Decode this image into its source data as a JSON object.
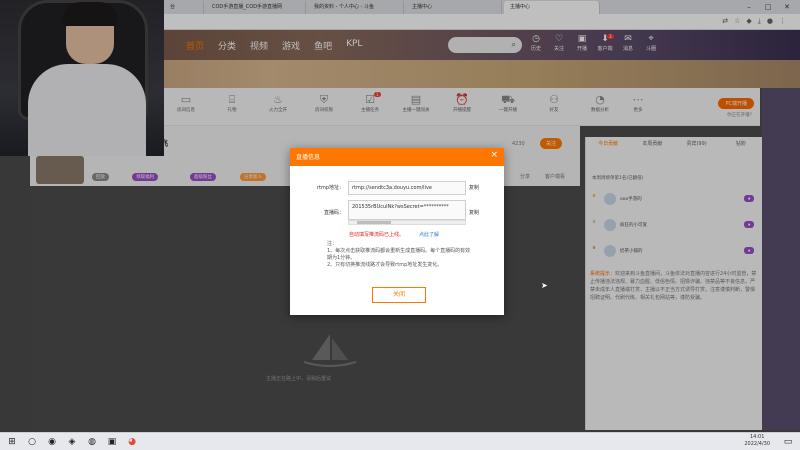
{
  "browser": {
    "tabs": [
      {
        "label": "台"
      },
      {
        "label": "COD手游直播_COD手游直播网"
      },
      {
        "label": "我的资料 - 个人中心 - 斗鱼"
      },
      {
        "label": "主播中心"
      },
      {
        "label": "主播中心"
      }
    ],
    "window_controls": [
      "–",
      "□",
      "✕"
    ]
  },
  "site": {
    "nav": [
      "首页",
      "分类",
      "视频",
      "游戏",
      "鱼吧",
      "KPL"
    ],
    "header_icons": [
      {
        "label": "历史"
      },
      {
        "label": "关注"
      },
      {
        "label": "开播"
      },
      {
        "label": "客户端"
      },
      {
        "label": "消息"
      },
      {
        "label": "斗圈"
      }
    ],
    "header_badge": "3",
    "toolbar": [
      {
        "label": "房间信息"
      },
      {
        "label": "礼物"
      },
      {
        "label": "火力全开"
      },
      {
        "label": "房间权限"
      },
      {
        "label": "主播任务"
      },
      {
        "label": "主播一键闯关"
      },
      {
        "label": "开播提醒"
      },
      {
        "label": "一键开播"
      },
      {
        "label": "好友"
      },
      {
        "label": "数据分析"
      },
      {
        "label": "更多"
      }
    ],
    "toolbar_badge": "1",
    "pc_button": "PC端开播",
    "pc_sub": "你正在开播?",
    "follow_count": "4230",
    "follow_label": "关注"
  },
  "room": {
    "anchor_name": "超飞",
    "tags": [
      "回放",
      "领取福利",
      "超级粉丝",
      "分享新人"
    ],
    "actions": [
      "分享",
      "客户端看"
    ],
    "offline_text": "主播正在路上中，请稍后重试"
  },
  "right_panel": {
    "tabs": [
      "今日贡献",
      "本周贡献",
      "贵宾(99)",
      "钻粉"
    ],
    "top_link": "本周周榜单第1名(已翻倍)",
    "ranks": [
      {
        "name": "ooo手游的"
      },
      {
        "name": "疯狂的小可爱"
      },
      {
        "name": "奶茶小铺的"
      }
    ],
    "notice_title": "系统提示：",
    "notice_text": "欢迎来到斗鱼直播间，斗鱼依法对直播内容进行24小时监管，禁止传播违法违规、暴力血腥、低俗色情、招嫖诈骗、违禁品等不良信息。严禁未成年人直播或打赏，主播以不正当方式诱导打赏，注意谨慎判断，警惕招聘证明、代刷代练、相关礼包网站等，谨防受骗。"
  },
  "modal": {
    "title": "直播信息",
    "rtmp_label": "rtmp地址：",
    "rtmp_value": "rtmp://sendtc3a.douyu.com/live",
    "key_label": "直播码：",
    "key_value": "201535rBUcuINk?wsSecret=**********",
    "copy_label": "复制",
    "warn_text": "自动填写推流码已上线。",
    "learn_text": "点此了解",
    "note_text": "注：\n1、每次点击获取推流码都会重新生成直播码。每个直播码的有效期为1分钟。\n2、只有切换推流线路才会导致rtmp地址发生变化。",
    "close_label": "关闭"
  },
  "taskbar": {
    "time": "14:01",
    "date": "2022/4/30"
  }
}
